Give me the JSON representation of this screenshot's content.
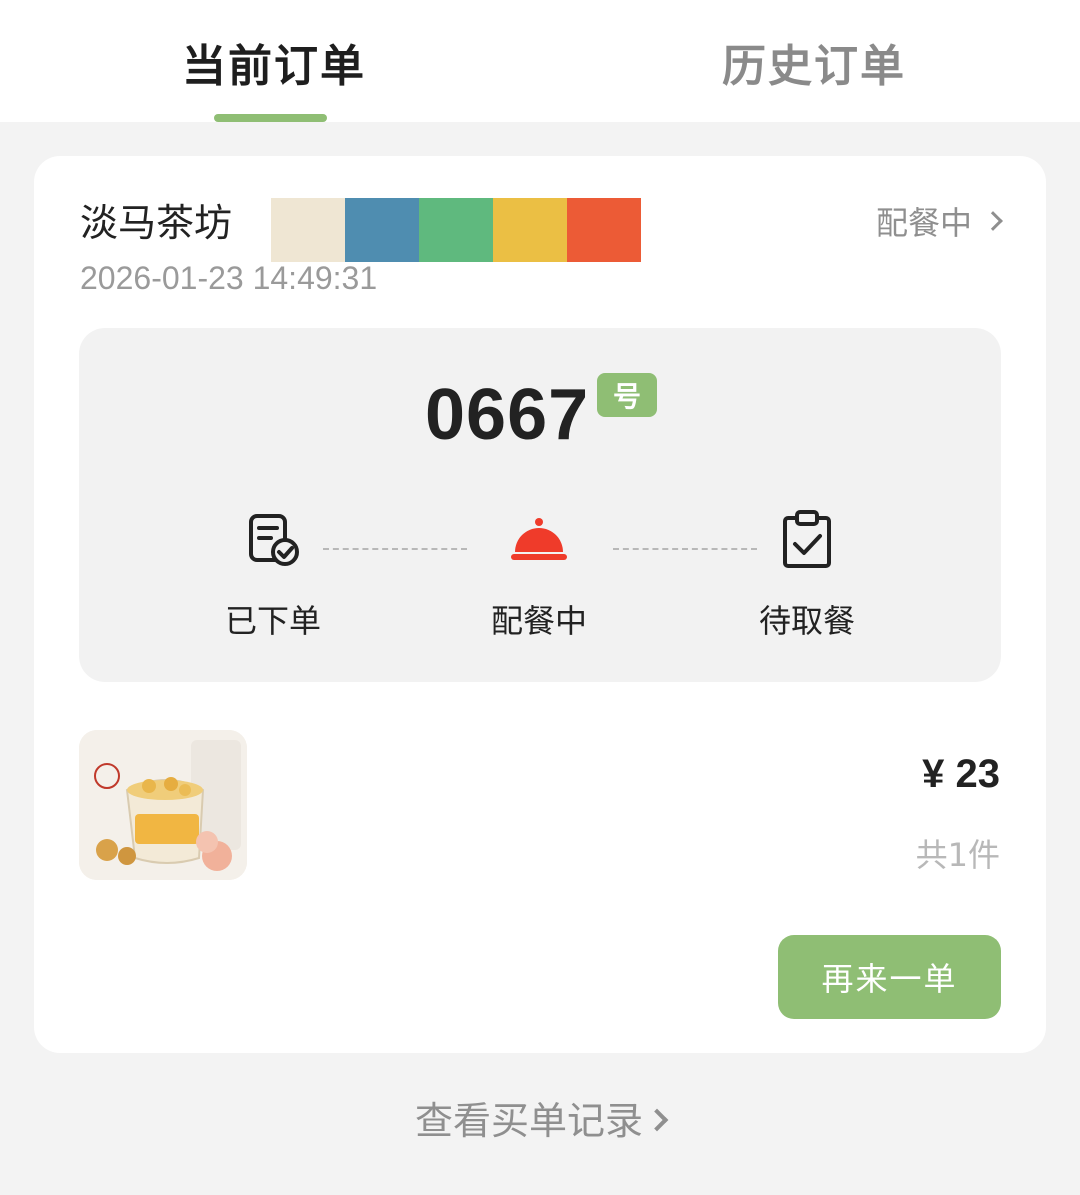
{
  "tabs": {
    "current": "当前订单",
    "history": "历史订单"
  },
  "colors": {
    "accent_green": "#8fbe74",
    "alert_red": "#ef3b2a"
  },
  "order": {
    "shop_name": "淡马茶坊",
    "time": "2026-01-23 14:49:31",
    "status_link": "配餐中",
    "pickup_number": "0667",
    "number_badge": "号",
    "steps": [
      {
        "label": "已下单",
        "icon": "order-placed-icon"
      },
      {
        "label": "配餐中",
        "icon": "food-cloche-icon"
      },
      {
        "label": "待取餐",
        "icon": "clipboard-check-icon"
      }
    ],
    "price": "¥ 23",
    "item_count": "共1件",
    "reorder_label": "再来一单"
  },
  "footer": {
    "records_label": "查看买单记录"
  }
}
